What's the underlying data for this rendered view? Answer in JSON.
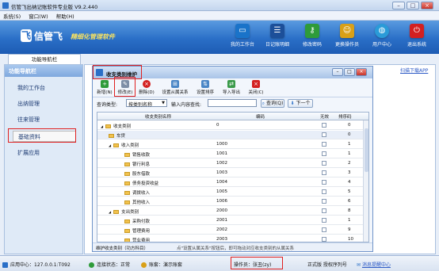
{
  "app": {
    "title": "信管飞出纳记账软件专业版 V9.2.440",
    "menu": [
      "系统(S)",
      "窗口(W)",
      "帮助(H)"
    ],
    "logo_text": "信管飞",
    "slogan": "精细化管理软件"
  },
  "toolbar": {
    "items": [
      {
        "label": "我的工作台",
        "icon": "desktop-icon",
        "color": "#1a73c9"
      },
      {
        "label": "日记账明细",
        "icon": "ledger-icon",
        "color": "#1c4f99"
      },
      {
        "label": "修改密码",
        "icon": "key-user-icon",
        "color": "#2e9b3a"
      },
      {
        "label": "更换操作员",
        "icon": "switch-user-icon",
        "color": "#d9a017"
      },
      {
        "label": "用户中心",
        "icon": "globe-icon",
        "color": "#2a9bd8"
      },
      {
        "label": "退出系统",
        "icon": "power-icon",
        "color": "#d32020"
      }
    ]
  },
  "nav": {
    "tab": "功能导航栏",
    "header": "功能导航栏",
    "items": [
      "我的工作台",
      "出纳管理",
      "往来管理",
      "基础资料",
      "扩展应用"
    ],
    "selected": "基础资料",
    "help_link": "扫描下载APP"
  },
  "dialog": {
    "title": "收支类别维护",
    "buttons": [
      {
        "label": "新增(N)",
        "icon": "add-icon",
        "color": "#2e9b3a"
      },
      {
        "label": "修改(E)",
        "icon": "edit-icon",
        "color": "#7d8ea6"
      },
      {
        "label": "删除(D)",
        "icon": "delete-icon",
        "color": "#d32020"
      },
      {
        "label": "设置从属关系",
        "icon": "relation-icon",
        "color": "#4a86c6"
      },
      {
        "label": "设置排序",
        "icon": "sort-icon",
        "color": "#4a86c6"
      },
      {
        "label": "导入导出",
        "icon": "import-export-icon",
        "color": "#3a9a4a"
      },
      {
        "label": "关闭(C)",
        "icon": "close-icon",
        "color": "#d32020"
      }
    ],
    "search": {
      "type_label": "查询类型:",
      "type_value": "按类别名称",
      "input_label": "输入内容查找:",
      "input_value": "",
      "query_button": "查询(Q)",
      "next_button": "下一个"
    },
    "columns": [
      "收支类别名称",
      "编码",
      "无效",
      "排序码"
    ],
    "rows": [
      {
        "name": "收支类别",
        "code": "0",
        "sort": "0",
        "level": 0,
        "expand": "◢",
        "selected": false
      },
      {
        "name": "车贷",
        "code": "",
        "sort": "0",
        "level": 1,
        "expand": "",
        "selected": true
      },
      {
        "name": "收入类别",
        "code": "1000",
        "sort": "1",
        "level": 1,
        "expand": "◢",
        "selected": false
      },
      {
        "name": "销售收款",
        "code": "1001",
        "sort": "1",
        "level": 2,
        "expand": "",
        "selected": false
      },
      {
        "name": "银行利息",
        "code": "1002",
        "sort": "2",
        "level": 2,
        "expand": "",
        "selected": false
      },
      {
        "name": "股东借款",
        "code": "1003",
        "sort": "3",
        "level": 2,
        "expand": "",
        "selected": false
      },
      {
        "name": "债务投资收益",
        "code": "1004",
        "sort": "4",
        "level": 2,
        "expand": "",
        "selected": false
      },
      {
        "name": "调拨收入",
        "code": "1005",
        "sort": "5",
        "level": 2,
        "expand": "",
        "selected": false
      },
      {
        "name": "其他收入",
        "code": "1006",
        "sort": "6",
        "level": 2,
        "expand": "",
        "selected": false
      },
      {
        "name": "支出类别",
        "code": "2000",
        "sort": "8",
        "level": 1,
        "expand": "◢",
        "selected": false
      },
      {
        "name": "采购付款",
        "code": "2001",
        "sort": "1",
        "level": 2,
        "expand": "",
        "selected": false
      },
      {
        "name": "管理费用",
        "code": "2002",
        "sort": "9",
        "level": 2,
        "expand": "",
        "selected": false
      },
      {
        "name": "营业费用",
        "code": "2003",
        "sort": "10",
        "level": 2,
        "expand": "",
        "selected": false
      }
    ],
    "status_left": "维护收支类别（功方科目）",
    "status_right": "点\"设置从属关系\"按钮后，即可拖动对应收支类别的从属关系"
  },
  "statusbar": {
    "app_center": "应用中心：127.0.0.1:T092",
    "connection": "连接状态：正常",
    "account": "账套：演示账套",
    "operator": "操作员：张丑(zy)",
    "edition": "正式版 授权序列号",
    "message": "消息提醒中心"
  }
}
